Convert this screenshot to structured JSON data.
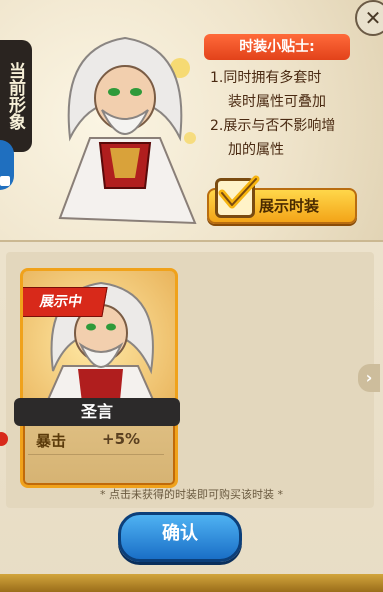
{
  "current_image_label": "当前形象",
  "tips": {
    "title": "时装小贴士:",
    "items": [
      {
        "num": "1.",
        "line1": "同时拥有多套时",
        "line2": "装时属性可叠加"
      },
      {
        "num": "2.",
        "line1": "展示与否不影响增",
        "line2": "加的属性"
      }
    ]
  },
  "show_toggle": {
    "label": "展示时装",
    "checked": true
  },
  "card": {
    "ribbon": "展示中",
    "name": "圣言",
    "stat_name": "暴击",
    "stat_value": "+5%"
  },
  "hint_text": "* 点击未获得的时装即可购买该时装 *",
  "confirm_label": "确认",
  "colors": {
    "accent_orange": "#f0a21b",
    "ribbon_red": "#d8291a",
    "confirm_blue": "#1a6fc7"
  }
}
